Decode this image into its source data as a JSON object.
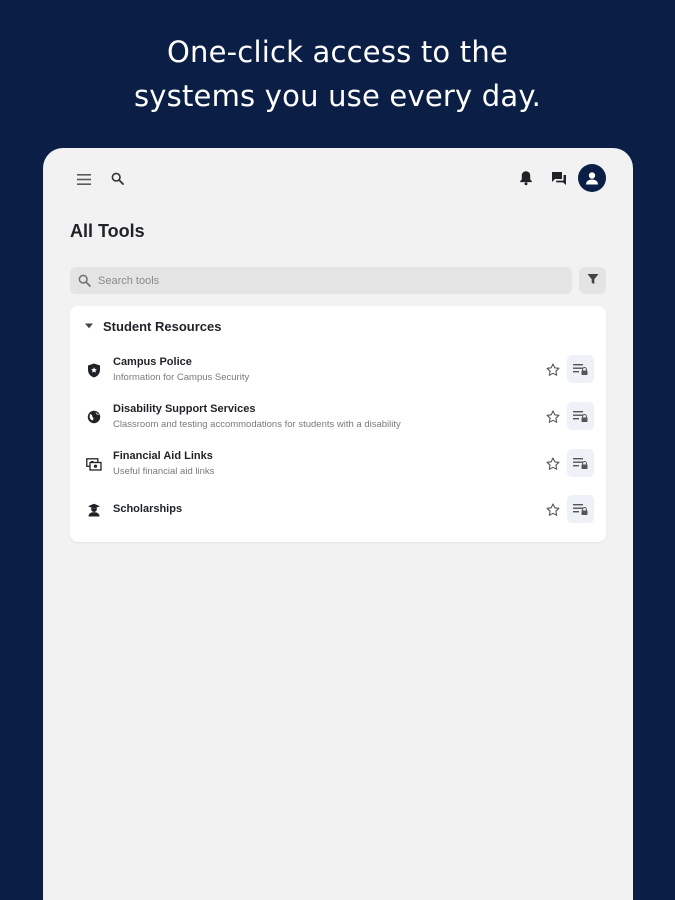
{
  "hero": {
    "line1": "One-click access to the",
    "line2": "systems you use every day."
  },
  "colors": {
    "brand_navy": "#0b1e46",
    "app_background": "#f2f2f2",
    "card_background": "#ffffff",
    "search_background": "#e4e4e4",
    "launch_button_background": "#eef1f8"
  },
  "topbar": {
    "icons": [
      "menu-icon",
      "search-icon",
      "bell-icon",
      "chat-icon",
      "account-icon"
    ]
  },
  "page": {
    "title": "All Tools"
  },
  "search": {
    "placeholder": "Search tools",
    "value": ""
  },
  "section": {
    "title": "Student Resources",
    "expanded": true,
    "tools": [
      {
        "name": "Campus Police",
        "description": "Information for Campus Security",
        "icon": "police-badge-icon"
      },
      {
        "name": "Disability Support Services",
        "description": "Classroom and testing accommodations for students with a disability",
        "icon": "globe-icon"
      },
      {
        "name": "Financial Aid Links",
        "description": "Useful financial aid links",
        "icon": "money-icon"
      },
      {
        "name": "Scholarships",
        "description": "",
        "icon": "graduate-icon"
      }
    ]
  }
}
